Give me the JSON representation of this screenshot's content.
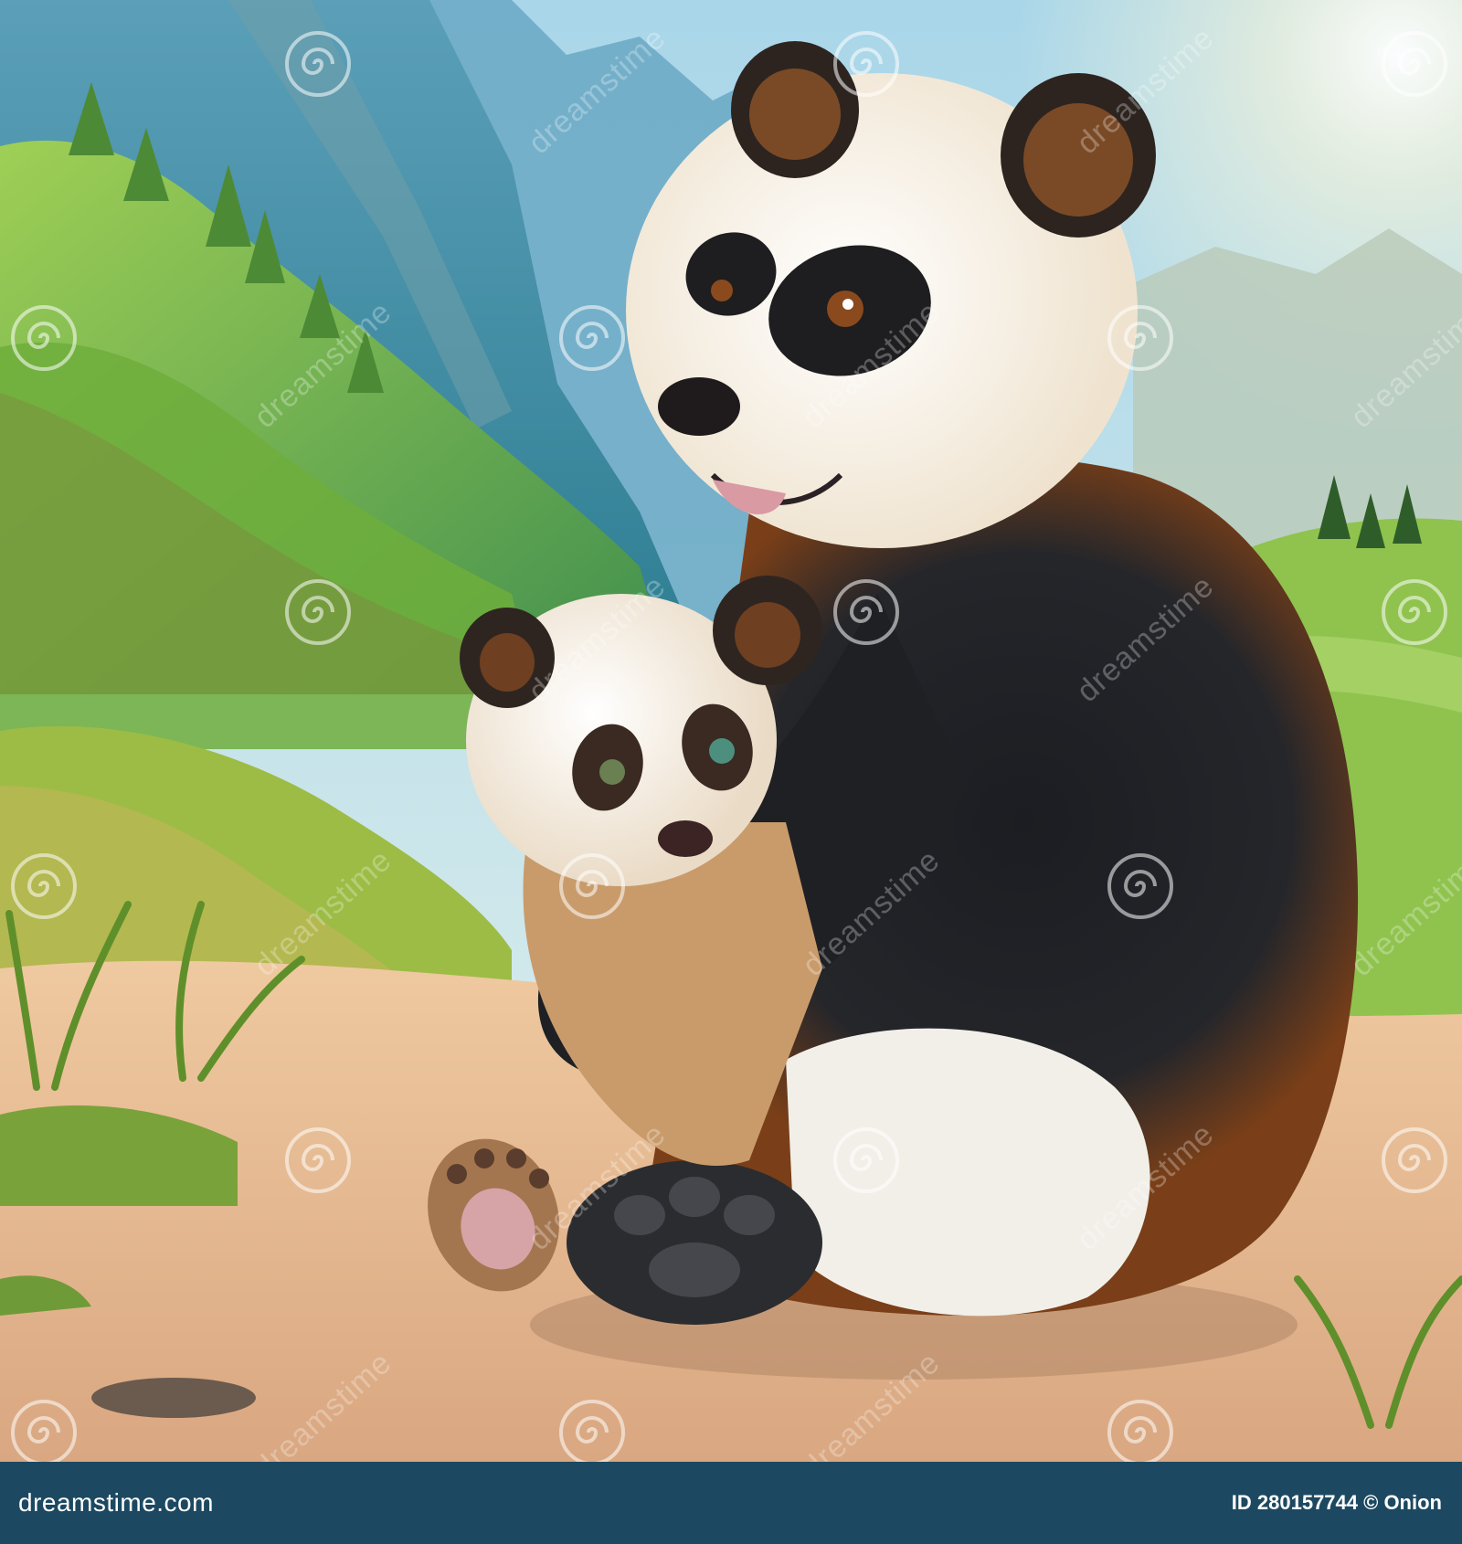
{
  "image": {
    "subject": "panda-mother-and-cub-illustration",
    "palette": {
      "sky": "#bfe3ee",
      "mountain": "#3f8ea0",
      "hills": "#8cc04a",
      "ground": "#e6b98f",
      "fur_black": "#232628",
      "fur_white": "#f3ece0",
      "fur_brown": "#8a4a1e"
    }
  },
  "watermark": {
    "text": "dreamstime",
    "icon": "spiral-icon"
  },
  "footer": {
    "brand": "dreamstime.com",
    "id_label": "ID 280157744 © Onion",
    "background": "#1c4961"
  }
}
